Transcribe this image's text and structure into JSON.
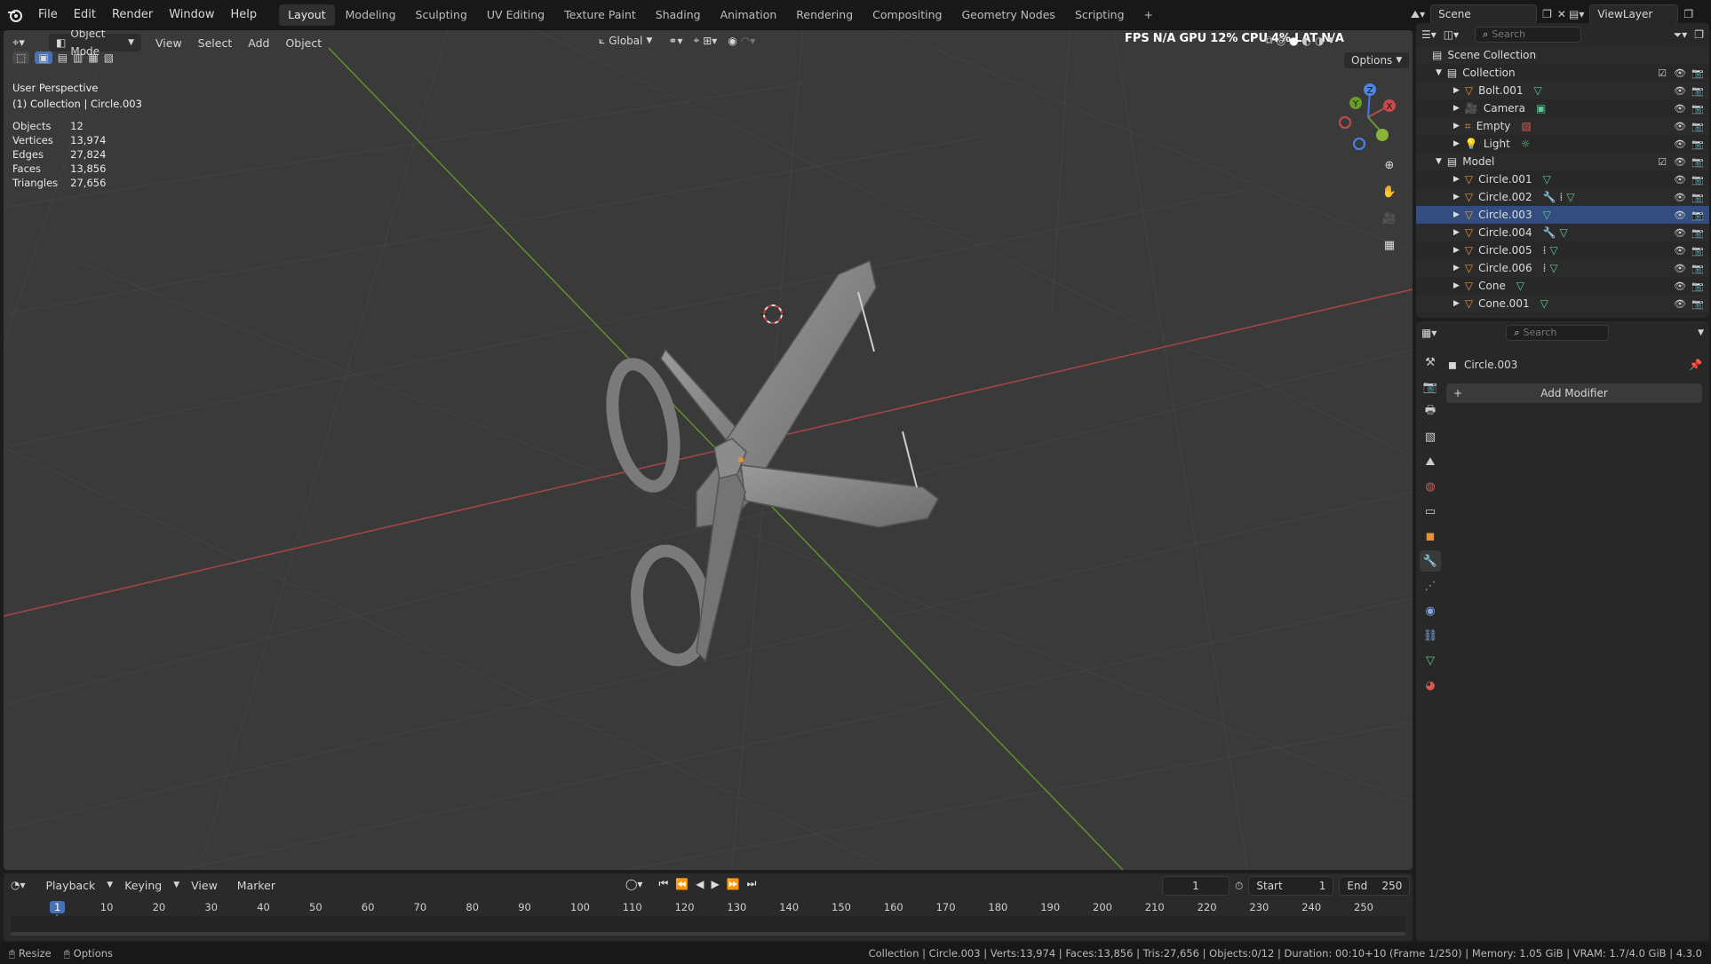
{
  "menu": {
    "items": [
      "File",
      "Edit",
      "Render",
      "Window",
      "Help"
    ]
  },
  "workspaces": {
    "tabs": [
      "Layout",
      "Modeling",
      "Sculpting",
      "UV Editing",
      "Texture Paint",
      "Shading",
      "Animation",
      "Rendering",
      "Compositing",
      "Geometry Nodes",
      "Scripting"
    ],
    "active": "Layout",
    "add": "+"
  },
  "scene": {
    "name": "Scene",
    "view_layer": "ViewLayer"
  },
  "viewport": {
    "mode": "Object Mode",
    "menus": [
      "View",
      "Select",
      "Add",
      "Object"
    ],
    "orientation": "Global",
    "options": "Options",
    "perf": {
      "fps_label": "FPS",
      "fps": "N/A",
      "gpu_label": "GPU",
      "gpu": "12%",
      "cpu_label": "CPU",
      "cpu": "4%",
      "lat_label": "LAT",
      "lat": "N/A"
    },
    "perspective": "User Perspective",
    "context": "(1) Collection | Circle.003",
    "stats": [
      {
        "label": "Objects",
        "value": "12"
      },
      {
        "label": "Vertices",
        "value": "13,974"
      },
      {
        "label": "Edges",
        "value": "27,824"
      },
      {
        "label": "Faces",
        "value": "13,856"
      },
      {
        "label": "Triangles",
        "value": "27,656"
      }
    ],
    "gizmo": {
      "x": "X",
      "y": "Y",
      "z": "Z"
    }
  },
  "outliner": {
    "search_placeholder": "Search",
    "root": "Scene Collection",
    "collections": [
      {
        "name": "Collection",
        "items": [
          "Bolt.001",
          "Camera",
          "Empty",
          "Light"
        ]
      },
      {
        "name": "Model",
        "items": [
          "Circle.001",
          "Circle.002",
          "Circle.003",
          "Circle.004",
          "Circle.005",
          "Circle.006",
          "Cone",
          "Cone.001"
        ]
      }
    ],
    "selected": "Circle.003"
  },
  "properties": {
    "search_placeholder": "Search",
    "object": "Circle.003",
    "add_modifier": "Add Modifier"
  },
  "timeline": {
    "menus": [
      "Playback",
      "Keying",
      "View",
      "Marker"
    ],
    "current_frame": "1",
    "start_label": "Start",
    "start": "1",
    "end_label": "End",
    "end": "250",
    "ticks": [
      "1",
      "10",
      "20",
      "30",
      "40",
      "50",
      "60",
      "70",
      "80",
      "90",
      "100",
      "110",
      "120",
      "130",
      "140",
      "150",
      "160",
      "170",
      "180",
      "190",
      "200",
      "210",
      "220",
      "230",
      "240",
      "250"
    ]
  },
  "status": {
    "left": [
      "Resize",
      "Options"
    ],
    "right": "Collection | Circle.003 | Verts:13,974 | Faces:13,856 | Tris:27,656 | Objects:0/12 | Duration: 00:10+10 (Frame 1/250) | Memory: 1.05 GiB | VRAM: 1.7/4.0 GiB | 4.3.0"
  },
  "colors": {
    "accent": "#4772b3",
    "x_axis": "#b44d4d",
    "y_axis": "#6a9a2a",
    "z_axis": "#3e7de0",
    "mesh_icon": "#e8933a",
    "data_icon": "#5ec98f"
  }
}
